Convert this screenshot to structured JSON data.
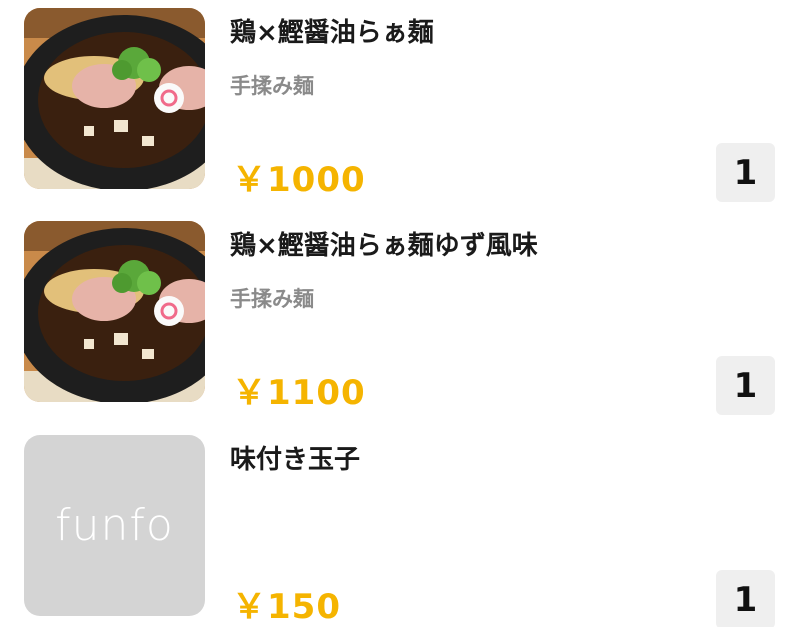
{
  "items": [
    {
      "name": "鶏×鰹醤油らぁ麺",
      "option": "手揉み麺",
      "price": "￥1000",
      "quantity": "1",
      "image": "ramen-photo"
    },
    {
      "name": "鶏×鰹醤油らぁ麺ゆず風味",
      "option": "手揉み麺",
      "price": "￥1100",
      "quantity": "1",
      "image": "ramen-photo"
    },
    {
      "name": "味付き玉子",
      "option": "",
      "price": "￥150",
      "quantity": "1",
      "image": "placeholder",
      "placeholder_logo": "funfo"
    }
  ],
  "colors": {
    "price": "#f5b400",
    "name": "#1a1a1a",
    "option": "#8a8a8a",
    "quantity_bg": "#efefef",
    "placeholder_bg": "#d4d4d4"
  }
}
